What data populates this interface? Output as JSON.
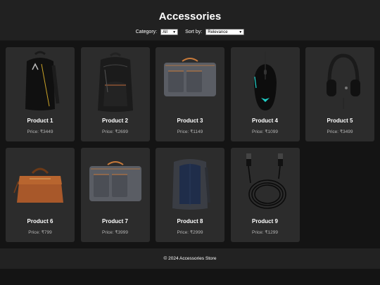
{
  "header": {
    "title": "Accessories"
  },
  "filters": {
    "category_label": "Category:",
    "category_value": "All",
    "sort_label": "Sort by:",
    "sort_value": "Relevance"
  },
  "products": [
    {
      "name": "Product 1",
      "price": "Price: ₹3449",
      "icon": "black-backpack-icon"
    },
    {
      "name": "Product 2",
      "price": "Price: ₹2699",
      "icon": "black-backpack-icon"
    },
    {
      "name": "Product 3",
      "price": "Price: ₹1149",
      "icon": "grey-laptop-bag-icon"
    },
    {
      "name": "Product 4",
      "price": "Price: ₹1099",
      "icon": "gaming-mouse-icon"
    },
    {
      "name": "Product 5",
      "price": "Price: ₹3499",
      "icon": "headphones-icon"
    },
    {
      "name": "Product 6",
      "price": "Price: ₹799",
      "icon": "leather-briefcase-icon"
    },
    {
      "name": "Product 7",
      "price": "Price: ₹3999",
      "icon": "grey-laptop-bag-icon"
    },
    {
      "name": "Product 8",
      "price": "Price: ₹2999",
      "icon": "navy-backpack-icon"
    },
    {
      "name": "Product 9",
      "price": "Price: ₹1299",
      "icon": "hdmi-cable-icon"
    }
  ],
  "footer": {
    "text": "© 2024 Accessories Store"
  }
}
